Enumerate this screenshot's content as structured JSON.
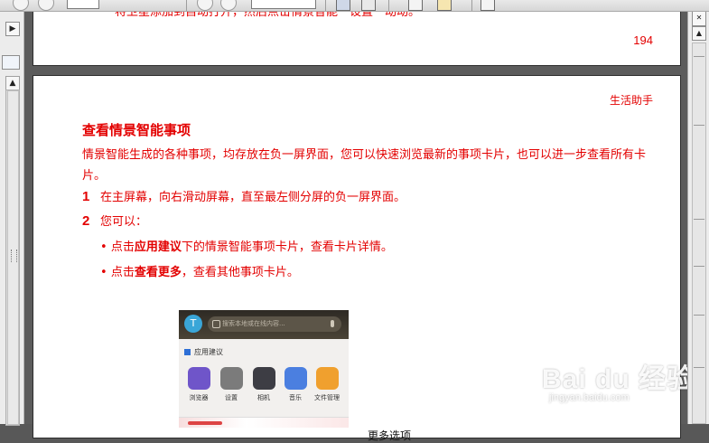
{
  "toolbar": {
    "page_field": "",
    "zoom_field": ""
  },
  "left_panel": {
    "expand_arrow": "▶",
    "scroll_up": "▲"
  },
  "right_panel": {
    "close_glyph": "✕",
    "scroll_up": "▲"
  },
  "prev_page": {
    "cut_text": "将卫星添加到自动打开，然后点击情景智能一设置一动动。",
    "page_number": "194"
  },
  "page": {
    "running_head": "生活助手",
    "section_title": "查看情景智能事项",
    "intro": "情景智能生成的各种事项，均存放在负一屏界面，您可以快速浏览最新的事项卡片，也可以进一步查看所有卡片。",
    "steps": [
      {
        "num": "1",
        "text": "在主屏幕，向右滑动屏幕，直至最左侧分屏的负一屏界面。"
      },
      {
        "num": "2",
        "text": "您可以："
      }
    ],
    "bullets": [
      {
        "marker": "•",
        "pre": "点击",
        "bold": "应用建议",
        "post": "下的情景智能事项卡片，查看卡片详情。"
      },
      {
        "marker": "•",
        "pre": "点击",
        "bold": "查看更多",
        "post": "，查看其他事项卡片。"
      }
    ],
    "callout_label": "更多选项"
  },
  "phone": {
    "search_placeholder": "搜索本地或在线内容...",
    "section_label": "应用建议",
    "apps": [
      {
        "label": "浏览器",
        "color": "#6f55c9"
      },
      {
        "label": "设置",
        "color": "#7b7b7b"
      },
      {
        "label": "相机",
        "color": "#3d3d44"
      },
      {
        "label": "音乐",
        "color": "#4b7fe0"
      },
      {
        "label": "文件管理",
        "color": "#f0a02e"
      }
    ]
  },
  "watermark": {
    "brand": "Bai du 经验",
    "url": "jingyan.baidu.com"
  }
}
